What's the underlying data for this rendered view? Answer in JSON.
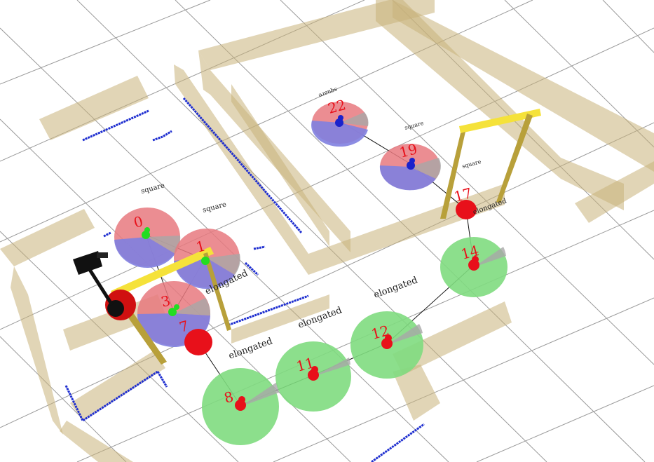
{
  "scene": {
    "colors": {
      "background": "#ffffff",
      "grid": "#9a9a9a",
      "wall": "#c8b27a",
      "scan": "#1f2fd0",
      "door": "#f5e23a",
      "door_post": "#b8a03a",
      "red": "#e8101a",
      "green": "#22dd22",
      "blue": "#1a22cc",
      "disc_green": "#7fdc7f",
      "disc_red": "#e8797f",
      "disc_blue": "#7f7fe0",
      "disc_gray": "#a8a8a8",
      "edge": "#101010"
    },
    "nodes": [
      {
        "id": "0",
        "label": "0",
        "kind": "square"
      },
      {
        "id": "1",
        "label": "1",
        "kind": "square"
      },
      {
        "id": "3",
        "label": "3",
        "kind": "square"
      },
      {
        "id": "7",
        "label": "7",
        "kind": "door"
      },
      {
        "id": "8",
        "label": "8",
        "kind": "elongated"
      },
      {
        "id": "11",
        "label": "11",
        "kind": "elongated"
      },
      {
        "id": "12",
        "label": "12",
        "kind": "elongated"
      },
      {
        "id": "14",
        "label": "14",
        "kind": "elongated"
      },
      {
        "id": "17",
        "label": "17",
        "kind": "door"
      },
      {
        "id": "19",
        "label": "19",
        "kind": "square"
      },
      {
        "id": "22",
        "label": "22",
        "kind": "square"
      }
    ],
    "place_labels": {
      "square_a": "square",
      "square_b": "square",
      "square_c": "square",
      "square_d": "square",
      "square_e": "square",
      "elongated_a": "elongated",
      "elongated_b": "elongated",
      "elongated_c": "elongated",
      "elongated_d": "elongated",
      "elongated_e": "elongated",
      "elongated_f": "elongated"
    }
  }
}
